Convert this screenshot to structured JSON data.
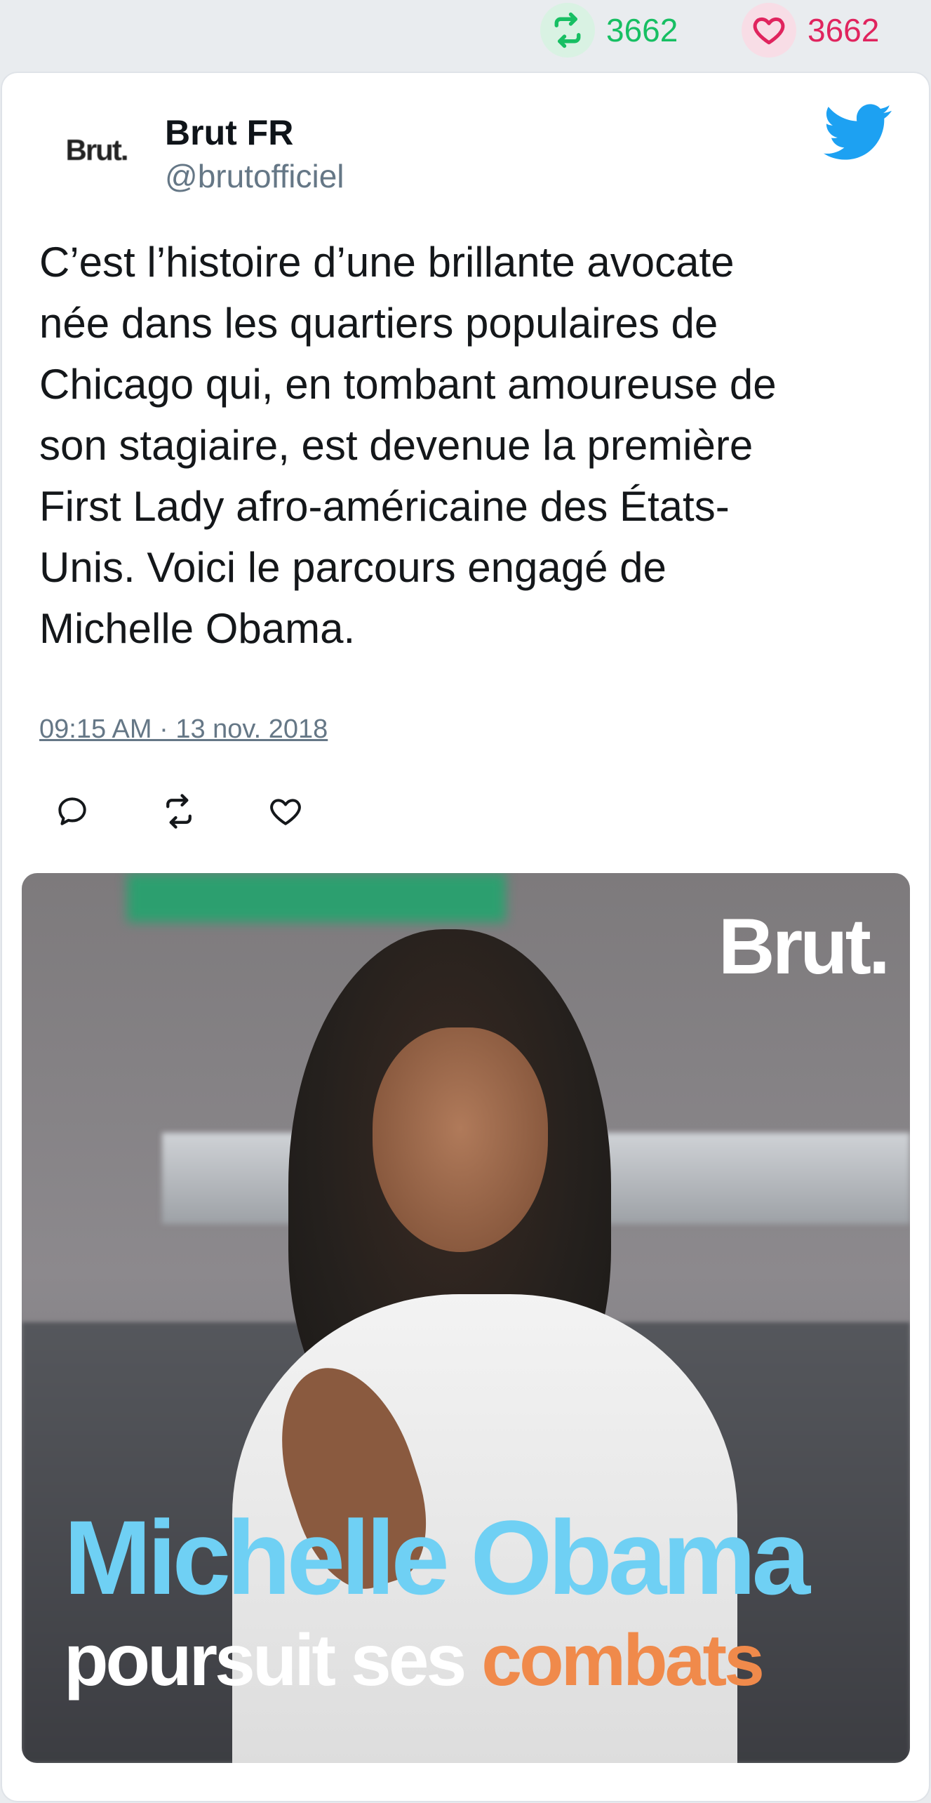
{
  "stats": {
    "retweets": "3662",
    "likes": "3662"
  },
  "tweet": {
    "author_name": "Brut FR",
    "author_handle": "@brutofficiel",
    "avatar_text": "Brut.",
    "text": "C’est l’histoire d’une brillante avocate\nnée dans les quartiers populaires de\nChicago qui, en tombant amoureuse de\nson stagiaire, est devenue la première\nFirst Lady afro-américaine des États-\nUnis. Voici le parcours engagé de\nMichelle Obama.",
    "timestamp": "09:15 AM · 13 nov. 2018"
  },
  "media": {
    "logo_text": "Brut.",
    "caption_line1": "Michelle Obama",
    "caption_line2_part1": "poursuit ses ",
    "caption_line2_part2": "combats"
  },
  "icons": {
    "retweet": "retweet-icon",
    "like": "heart-icon",
    "reply": "reply-icon",
    "twitter": "twitter-bird-icon"
  },
  "colors": {
    "retweet_green": "#17bf63",
    "like_red": "#e0245e",
    "twitter_blue": "#1da1f2",
    "muted": "#657786",
    "caption_blue": "#6fd0f4",
    "caption_orange": "#f08a4b"
  }
}
